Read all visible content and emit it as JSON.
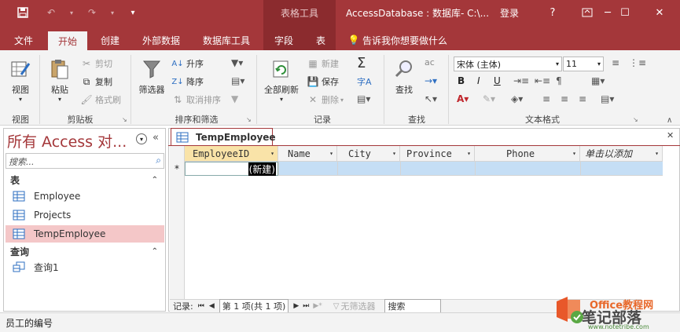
{
  "title_bar": {
    "context_tab_group": "表格工具",
    "window_title": "AccessDatabase : 数据库- C:\\...",
    "login": "登录",
    "help": "?"
  },
  "ribbon_tabs": [
    {
      "label": "文件"
    },
    {
      "label": "开始"
    },
    {
      "label": "创建"
    },
    {
      "label": "外部数据"
    },
    {
      "label": "数据库工具"
    },
    {
      "label": "字段"
    },
    {
      "label": "表"
    }
  ],
  "tell_me": "告诉我你想要做什么",
  "ribbon": {
    "view": {
      "button": "视图",
      "group": "视图"
    },
    "clipboard": {
      "paste": "粘贴",
      "cut": "剪切",
      "copy": "复制",
      "format_painter": "格式刷",
      "group": "剪贴板"
    },
    "sort_filter": {
      "filter": "筛选器",
      "ascending": "升序",
      "descending": "降序",
      "remove_sort": "取消排序",
      "group": "排序和筛选"
    },
    "records": {
      "refresh_all": "全部刷新",
      "new": "新建",
      "save": "保存",
      "delete": "删除",
      "group": "记录"
    },
    "find": {
      "find": "查找",
      "group": "查找"
    },
    "text_format": {
      "font_name": "宋体 (主体)",
      "font_size": "11",
      "bold": "B",
      "italic": "I",
      "underline": "U",
      "group": "文本格式"
    }
  },
  "nav_pane": {
    "title": "所有 Access 对...",
    "search_placeholder": "搜索...",
    "categories": [
      {
        "label": "表",
        "items": [
          "Employee",
          "Projects",
          "TempEmployee"
        ]
      },
      {
        "label": "查询",
        "items": [
          "查询1"
        ]
      }
    ],
    "selected_item": "TempEmployee"
  },
  "document": {
    "tab_label": "TempEmployee",
    "columns": [
      "EmployeeID",
      "Name",
      "City",
      "Province",
      "Phone",
      "单击以添加"
    ],
    "new_row_marker": "*",
    "new_row_value": "(新建)"
  },
  "record_nav": {
    "label": "记录:",
    "position": "第 1 项(共 1 项)",
    "filter": "无筛选器",
    "search": "搜索"
  },
  "status_bar": {
    "text": "员工的编号"
  },
  "watermark": {
    "line1": "Office教程网",
    "line2": "笔记部落",
    "url": "www.notetribe.com"
  },
  "colors": {
    "accent": "#a4373a",
    "context": "#8b2b2e",
    "selected_row": "#c5def5",
    "nav_selected": "#f4c7c8"
  }
}
